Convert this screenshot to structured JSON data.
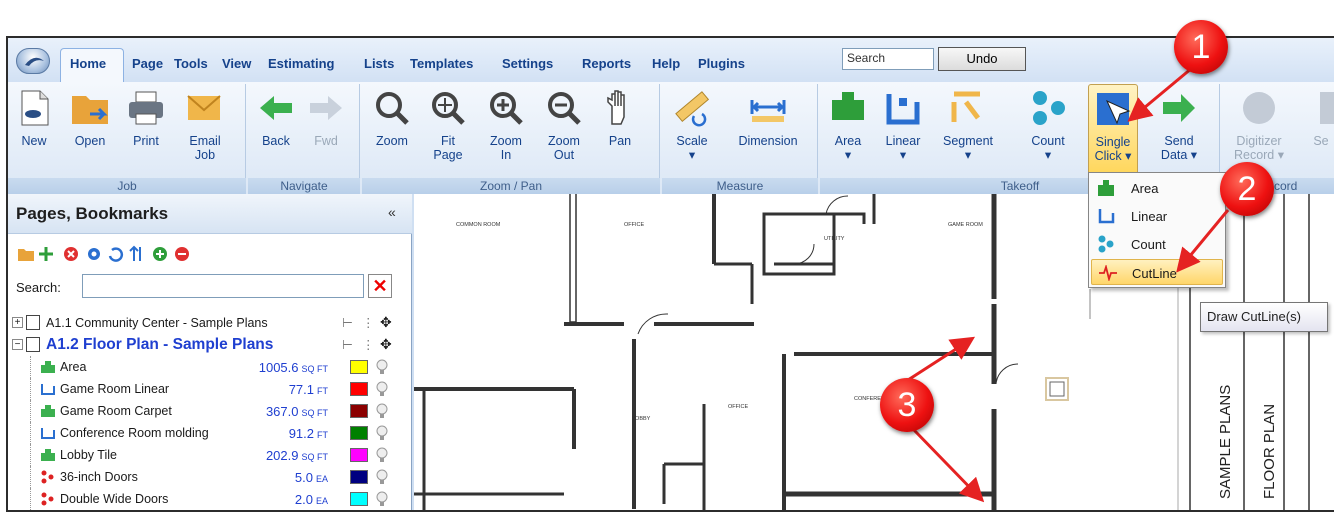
{
  "tabs": [
    "Home",
    "Page",
    "Tools",
    "View",
    "Estimating",
    "Lists",
    "Templates",
    "Settings",
    "Reports",
    "Help",
    "Plugins"
  ],
  "search_value": "Search",
  "undo_label": "Undo",
  "groups": {
    "job": {
      "label": "Job",
      "buttons": [
        {
          "l1": "New",
          "l2": ""
        },
        {
          "l1": "Open",
          "l2": ""
        },
        {
          "l1": "Print",
          "l2": ""
        },
        {
          "l1": "Email",
          "l2": "Job"
        }
      ]
    },
    "navigate": {
      "label": "Navigate",
      "buttons": [
        {
          "l1": "Back",
          "l2": ""
        },
        {
          "l1": "Fwd",
          "l2": ""
        }
      ]
    },
    "zoom": {
      "label": "Zoom / Pan",
      "buttons": [
        {
          "l1": "Zoom",
          "l2": ""
        },
        {
          "l1": "Fit",
          "l2": "Page"
        },
        {
          "l1": "Zoom",
          "l2": "In"
        },
        {
          "l1": "Zoom",
          "l2": "Out"
        },
        {
          "l1": "Pan",
          "l2": ""
        }
      ]
    },
    "measure": {
      "label": "Measure",
      "buttons": [
        {
          "l1": "Scale",
          "l2": "▾"
        },
        {
          "l1": "Dimension",
          "l2": ""
        }
      ]
    },
    "takeoff": {
      "label": "Takeoff",
      "buttons": [
        {
          "l1": "Area",
          "l2": "▾"
        },
        {
          "l1": "Linear",
          "l2": "▾"
        },
        {
          "l1": "Segment",
          "l2": "▾"
        },
        {
          "l1": "Count",
          "l2": "▾"
        },
        {
          "l1": "Single",
          "l2": "Click ▾"
        },
        {
          "l1": "Send",
          "l2": "Data ▾"
        }
      ]
    },
    "record": {
      "label": "Record",
      "buttons": [
        {
          "l1": "Digitizer",
          "l2": "Record ▾"
        },
        {
          "l1": "Se",
          "l2": ""
        }
      ]
    }
  },
  "sidebar": {
    "title": "Pages, Bookmarks",
    "collapse": "«",
    "search_label": "Search:",
    "pages": [
      "A1.1 Community Center - Sample Plans",
      "A1.2 Floor Plan - Sample Plans"
    ],
    "items": [
      {
        "name": "Area",
        "value": "1005.6",
        "unit": "SQ FT",
        "color": "#ffff00",
        "icon": "area"
      },
      {
        "name": "Game Room Linear",
        "value": "77.1",
        "unit": "FT",
        "color": "#ff0000",
        "icon": "linear"
      },
      {
        "name": "Game Room Carpet",
        "value": "367.0",
        "unit": "SQ FT",
        "color": "#8b0000",
        "icon": "area"
      },
      {
        "name": "Conference Room molding",
        "value": "91.2",
        "unit": "FT",
        "color": "#008000",
        "icon": "linear"
      },
      {
        "name": "Lobby Tile",
        "value": "202.9",
        "unit": "SQ FT",
        "color": "#ff00ff",
        "icon": "area"
      },
      {
        "name": "36-inch Doors",
        "value": "5.0",
        "unit": "EA",
        "color": "#000080",
        "icon": "count"
      },
      {
        "name": "Double Wide Doors",
        "value": "2.0",
        "unit": "EA",
        "color": "#00ffff",
        "icon": "count"
      }
    ]
  },
  "menu": {
    "items": [
      "Area",
      "Linear",
      "Count",
      "CutLine"
    ]
  },
  "tooltip": "Draw CutLine(s)",
  "plan_labels": {
    "common_room": "COMMON ROOM",
    "office_top": "OFFICE",
    "utility": "UTILITY",
    "game_room": "GAME ROOM",
    "lobby": "LOBBY",
    "office_mid": "OFFICE",
    "conference": "CONFERENCE",
    "sample_plans": "SAMPLE PLANS",
    "floor_plan": "FLOOR PLAN"
  },
  "callouts": [
    "1",
    "2",
    "3"
  ]
}
